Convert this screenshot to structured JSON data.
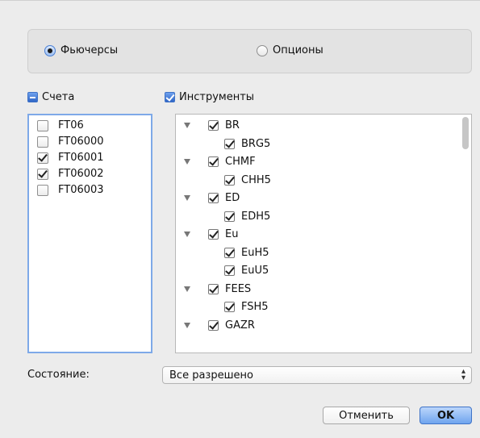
{
  "mode": {
    "futures_label": "Фьючерсы",
    "options_label": "Опционы",
    "selected": "futures"
  },
  "accounts": {
    "header": "Счета",
    "items": [
      {
        "label": "FT06",
        "checked": false
      },
      {
        "label": "FT06000",
        "checked": false
      },
      {
        "label": "FT06001",
        "checked": true
      },
      {
        "label": "FT06002",
        "checked": true
      },
      {
        "label": "FT06003",
        "checked": false
      }
    ]
  },
  "instruments": {
    "header": "Инструменты",
    "rows": [
      {
        "label": "BR",
        "level": 0,
        "checked": true
      },
      {
        "label": "BRG5",
        "level": 1,
        "checked": true
      },
      {
        "label": "CHMF",
        "level": 0,
        "checked": true
      },
      {
        "label": "CHH5",
        "level": 1,
        "checked": true
      },
      {
        "label": "ED",
        "level": 0,
        "checked": true
      },
      {
        "label": "EDH5",
        "level": 1,
        "checked": true
      },
      {
        "label": "Eu",
        "level": 0,
        "checked": true
      },
      {
        "label": "EuH5",
        "level": 1,
        "checked": true
      },
      {
        "label": "EuU5",
        "level": 1,
        "checked": true
      },
      {
        "label": "FEES",
        "level": 0,
        "checked": true
      },
      {
        "label": "FSH5",
        "level": 1,
        "checked": true
      },
      {
        "label": "GAZR",
        "level": 0,
        "checked": true
      }
    ]
  },
  "status": {
    "label": "Состояние:",
    "value": "Все разрешено"
  },
  "buttons": {
    "cancel": "Отменить",
    "ok": "OK"
  }
}
